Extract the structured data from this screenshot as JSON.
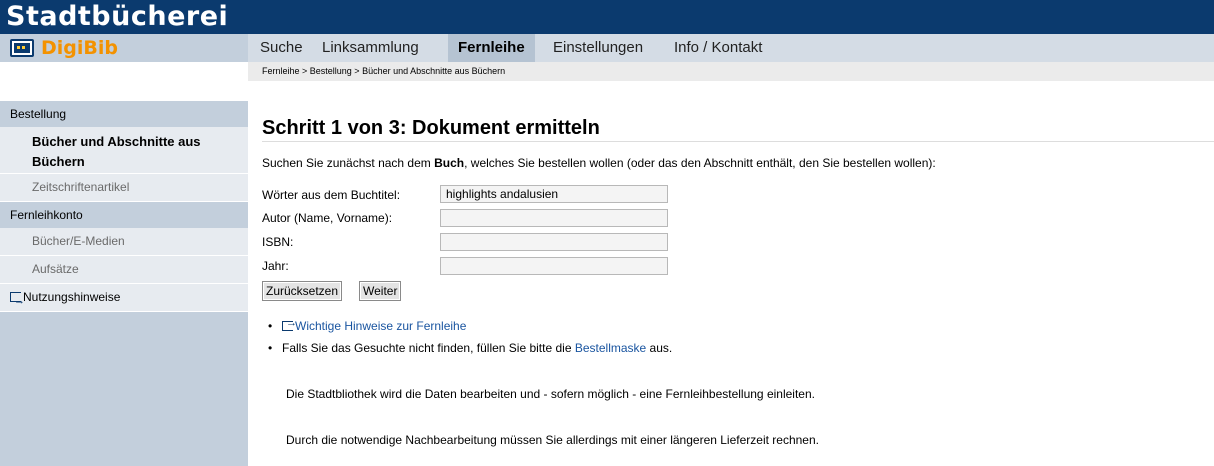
{
  "header": {
    "brand": "Stadtbücherei",
    "logo_text": "DigiBib"
  },
  "nav": {
    "tabs": [
      {
        "label": "Suche",
        "active": false
      },
      {
        "label": "Linksammlung",
        "active": false
      },
      {
        "label": "Fernleihe",
        "active": true
      },
      {
        "label": "Einstellungen",
        "active": false
      },
      {
        "label": "Info / Kontakt",
        "active": false
      }
    ]
  },
  "breadcrumb": "Fernleihe > Bestellung > Bücher und Abschnitte aus Büchern",
  "sidebar": {
    "section_order": "Bestellung",
    "item_books_line1": "Bücher und Abschnitte aus",
    "item_books_line2": "Büchern",
    "item_journals": "Zeitschriftenartikel",
    "section_account": "Fernleihkonto",
    "item_media": "Bücher/E-Medien",
    "item_articles": "Aufsätze",
    "item_usage": "Nutzungshinweise"
  },
  "main": {
    "title": "Schritt 1 von 3: Dokument ermitteln",
    "intro_before": "Suchen Sie zunächst nach dem ",
    "intro_bold": "Buch",
    "intro_after": ", welches Sie bestellen wollen (oder das den Abschnitt enthält, den Sie bestellen wollen):",
    "fields": {
      "title_label": "Wörter aus dem Buchtitel:",
      "title_value": "highlights andalusien",
      "author_label": "Autor (Name, Vorname):",
      "author_value": "",
      "isbn_label": "ISBN:",
      "isbn_value": "",
      "year_label": "Jahr:",
      "year_value": ""
    },
    "reset_label": "Zurücksetzen",
    "next_label": "Weiter",
    "hint_link": "Wichtige Hinweise zur Fernleihe",
    "notfound_before": "Falls Sie das Gesuchte nicht finden, füllen Sie bitte die ",
    "notfound_link": "Bestellmaske",
    "notfound_after": " aus.",
    "para1": "Die Stadtbliothek wird die Daten bearbeiten und - sofern möglich - eine Fernleihbestellung einleiten.",
    "para2": "Durch die notwendige Nachbearbeitung müssen Sie allerdings mit einer längeren Lieferzeit rechnen."
  },
  "colors": {
    "brand_blue": "#0b3a6e",
    "logo_orange": "#f39200",
    "link_blue": "#1a55a0",
    "sidebar_bg": "#c3cfdc"
  }
}
